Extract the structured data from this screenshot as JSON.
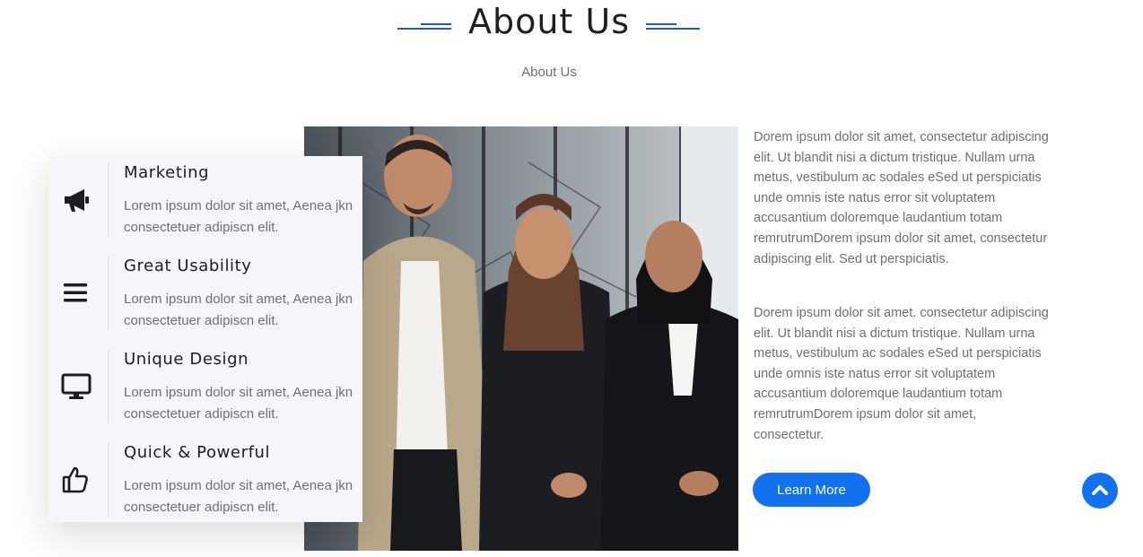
{
  "header": {
    "title": "About Us",
    "subtitle": "About Us"
  },
  "features": [
    {
      "icon": "megaphone-icon",
      "title": "Marketing",
      "description": "Lorem ipsum dolor sit amet, Aenea jkn consectetuer adipiscn elit."
    },
    {
      "icon": "menu-bars-icon",
      "title": "Great Usability",
      "description": "Lorem ipsum dolor sit amet, Aenea jkn consectetuer adipiscn elit."
    },
    {
      "icon": "monitor-icon",
      "title": "Unique Design",
      "description": "Lorem ipsum dolor sit amet, Aenea jkn consectetuer adipiscn elit."
    },
    {
      "icon": "thumbs-up-icon",
      "title": "Quick & Powerful",
      "description": "Lorem ipsum dolor sit amet, Aenea jkn consectetuer adipiscn elit."
    }
  ],
  "content": {
    "paragraph_1": "Dorem ipsum dolor sit amet, consectetur adipiscing elit. Ut blandit nisi a dictum tristique. Nullam urna metus, vestibulum ac sodales eSed ut perspiciatis unde omnis iste natus error sit voluptatem accusantium doloremque laudantium totam remrutrumDorem ipsum dolor sit amet, consectetur adipiscing elit. Sed ut perspiciatis.",
    "paragraph_2": "Dorem ipsum dolor sit amet. consectetur adipiscing elit. Ut blandit nisi a dictum tristique. Nullam urna metus, vestibulum ac sodales eSed ut perspiciatis unde omnis iste natus error sit voluptatem accusantium doloremque laudantium totam remrutrumDorem ipsum dolor sit amet, consectetur.",
    "button_label": "Learn More"
  },
  "scroll_top": {
    "icon": "chevron-up-icon"
  },
  "colors": {
    "accent": "#1171ee",
    "title_line": "#1f5fa8",
    "heading": "#1c1d21",
    "body_text": "#6c6f74",
    "card_bg": "#f5f6f9"
  }
}
